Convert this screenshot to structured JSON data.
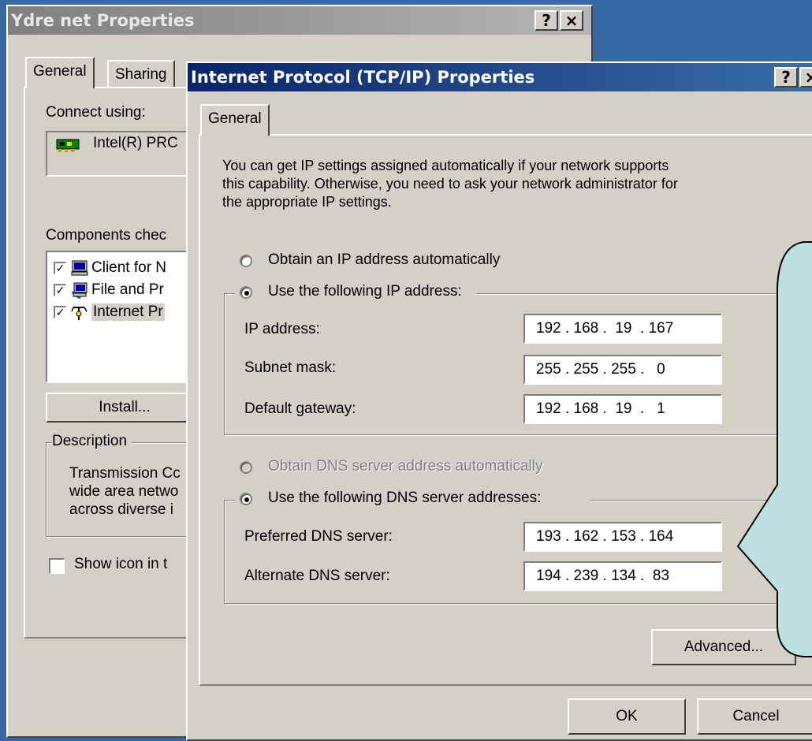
{
  "back_window": {
    "title": "Ydre net Properties",
    "help_glyph": "?",
    "close_glyph": "×",
    "tabs": [
      "General",
      "Sharing"
    ],
    "connect_using_label": "Connect using:",
    "adapter_name": "Intel(R) PRC",
    "components_label": "Components chec",
    "components": [
      {
        "label": "Client for N",
        "checked": true,
        "icon": "computer-icon"
      },
      {
        "label": "File and Pr",
        "checked": true,
        "icon": "share-icon"
      },
      {
        "label": "Internet Pr",
        "checked": true,
        "icon": "protocol-icon"
      }
    ],
    "install_label": "Install...",
    "description_legend": "Description",
    "description_lines": [
      "Transmission Cc",
      "wide area netwo",
      "across diverse i"
    ],
    "show_icon_label": "Show icon in t"
  },
  "front_window": {
    "title": "Internet Protocol (TCP/IP) Properties",
    "help_glyph": "?",
    "close_glyph": "×",
    "tab": "General",
    "intro_lines": [
      "You can get IP settings assigned automatically if your network supports",
      "this capability. Otherwise, you need to ask your network administrator for",
      "the appropriate IP settings."
    ],
    "ip_auto_label": "Obtain an IP address automatically",
    "ip_manual_label": "Use the following IP address:",
    "ip_address_label": "IP address:",
    "ip_address": "192 . 168 .  19  . 167",
    "subnet_label": "Subnet mask:",
    "subnet": "255 . 255 . 255 .   0",
    "gateway_label": "Default gateway:",
    "gateway": "192 . 168 .  19  .   1",
    "dns_auto_label": "Obtain DNS server address automatically",
    "dns_manual_label": "Use the following DNS server addresses:",
    "preferred_dns_label": "Preferred DNS server:",
    "preferred_dns": "193 . 162 . 153 . 164",
    "alternate_dns_label": "Alternate DNS server:",
    "alternate_dns": "194 . 239 . 134 .  83",
    "advanced_label": "Advanced...",
    "ok_label": "OK",
    "cancel_label": "Cancel"
  },
  "colors": {
    "titlebar_inactive": "#808080",
    "titlebar_active": "#0a246a",
    "callout_fill": "#bde0e0",
    "desktop": "#3a6aa4"
  }
}
